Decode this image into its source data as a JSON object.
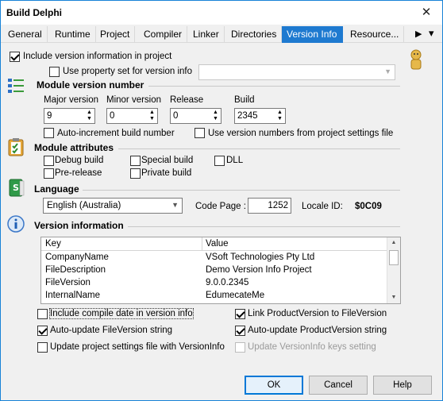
{
  "window": {
    "title": "Build Delphi",
    "close_glyph": "✕"
  },
  "tabs": [
    {
      "label": "General"
    },
    {
      "label": "Runtime"
    },
    {
      "label": "Project"
    },
    {
      "label": "Compiler"
    },
    {
      "label": "Linker"
    },
    {
      "label": "Directories"
    },
    {
      "label": "Version Info"
    },
    {
      "label": "Resource..."
    }
  ],
  "tab_scroll": {
    "right_glyph": "▶",
    "menu_glyph": "▾"
  },
  "include_version": {
    "label": "Include version information in project",
    "checked": true
  },
  "use_property_set": {
    "label": "Use property set for version info",
    "checked": false,
    "value": ""
  },
  "module_version": {
    "title": "Module version number",
    "major": {
      "label": "Major version",
      "value": "9"
    },
    "minor": {
      "label": "Minor version",
      "value": "0"
    },
    "release": {
      "label": "Release",
      "value": "0"
    },
    "build": {
      "label": "Build",
      "value": "2345"
    },
    "auto_increment": {
      "label": "Auto-increment build number",
      "checked": false
    },
    "use_project_numbers": {
      "label": "Use version numbers from project settings file",
      "checked": false
    }
  },
  "module_attributes": {
    "title": "Module attributes",
    "items": [
      {
        "label": "Debug build",
        "checked": false
      },
      {
        "label": "Special build",
        "checked": false
      },
      {
        "label": "DLL",
        "checked": false
      },
      {
        "label": "Pre-release",
        "checked": false
      },
      {
        "label": "Private build",
        "checked": false
      }
    ]
  },
  "language": {
    "title": "Language",
    "selected": "English (Australia)",
    "code_page_label": "Code Page :",
    "code_page": "1252",
    "locale_label": "Locale ID:",
    "locale_id": "$0C09"
  },
  "version_information": {
    "title": "Version information",
    "columns": [
      "Key",
      "Value"
    ],
    "rows": [
      [
        "CompanyName",
        "VSoft Technologies Pty Ltd"
      ],
      [
        "FileDescription",
        "Demo Version Info Project"
      ],
      [
        "FileVersion",
        "9.0.0.2345"
      ],
      [
        "InternalName",
        "EdumecateMe"
      ]
    ]
  },
  "options": {
    "include_compile_date": {
      "label": "Include compile date in version info",
      "checked": false
    },
    "link_product_version": {
      "label": "Link ProductVersion to FileVersion",
      "checked": true
    },
    "auto_update_file": {
      "label": "Auto-update FileVersion string",
      "checked": true
    },
    "auto_update_product": {
      "label": "Auto-update ProductVersion string",
      "checked": true
    },
    "update_project_settings": {
      "label": "Update project settings file with VersionInfo",
      "checked": false
    },
    "update_keys": {
      "label": "Update VersionInfo keys setting",
      "checked": false,
      "disabled": true
    }
  },
  "buttons": {
    "ok": "OK",
    "cancel": "Cancel",
    "help": "Help"
  }
}
